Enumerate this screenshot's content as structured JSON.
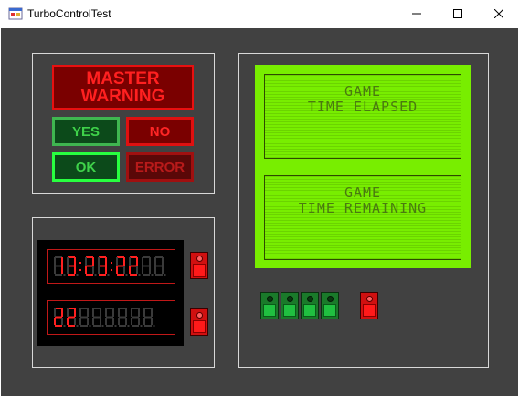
{
  "window": {
    "title": "TurboControlTest"
  },
  "warning_panel": {
    "master_warning": "MASTER\nWARNING",
    "yes_label": "YES",
    "no_label": "NO",
    "ok_label": "OK",
    "error_label": "ERROR"
  },
  "clock_panel": {
    "time_display": "13:23:22",
    "counter_display": "22"
  },
  "lcd_panel": {
    "elapsed_line1": "GAME",
    "elapsed_line2": "TIME ELAPSED",
    "remaining_line1": "GAME",
    "remaining_line2": "TIME REMAINING"
  },
  "colors": {
    "background": "#414141",
    "alarm_red": "#ff2020",
    "ok_green": "#3fd24a",
    "lcd_green": "#78ee00"
  }
}
